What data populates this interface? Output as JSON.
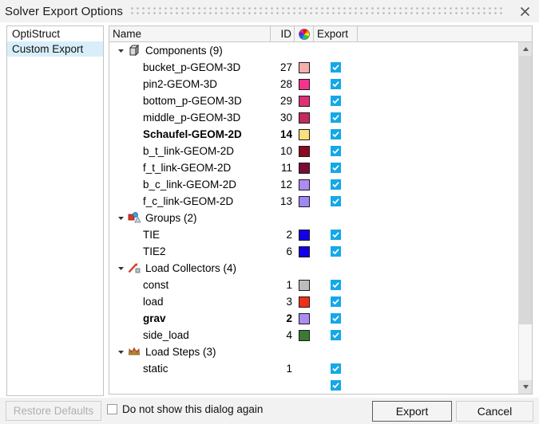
{
  "window": {
    "title": "Solver Export Options",
    "close_icon": "close-icon"
  },
  "left_list": {
    "items": [
      {
        "label": "OptiStruct",
        "selected": false
      },
      {
        "label": "Custom Export",
        "selected": true
      }
    ]
  },
  "tree": {
    "columns": {
      "name": "Name",
      "id": "ID",
      "color": "color-wheel-icon",
      "export": "Export"
    },
    "groups": [
      {
        "label": "Components (9)",
        "icon": "component-cube-icon",
        "expanded": true,
        "children": [
          {
            "name": "bucket_p-GEOM-3D",
            "id": "27",
            "color": "#f5b0ab",
            "export": true,
            "bold": false
          },
          {
            "name": "pin2-GEOM-3D",
            "id": "28",
            "color": "#f5338c",
            "export": true,
            "bold": false
          },
          {
            "name": "bottom_p-GEOM-3D",
            "id": "29",
            "color": "#e02e74",
            "export": true,
            "bold": false
          },
          {
            "name": "middle_p-GEOM-3D",
            "id": "30",
            "color": "#c42a5e",
            "export": true,
            "bold": false
          },
          {
            "name": "Schaufel-GEOM-2D",
            "id": "14",
            "color": "#f9e07c",
            "export": true,
            "bold": true
          },
          {
            "name": "b_t_link-GEOM-2D",
            "id": "10",
            "color": "#8c0a1e",
            "export": true,
            "bold": false
          },
          {
            "name": "f_t_link-GEOM-2D",
            "id": "11",
            "color": "#7d0a36",
            "export": true,
            "bold": false
          },
          {
            "name": "b_c_link-GEOM-2D",
            "id": "12",
            "color": "#ac8bf2",
            "export": true,
            "bold": false
          },
          {
            "name": "f_c_link-GEOM-2D",
            "id": "13",
            "color": "#a087f5",
            "export": true,
            "bold": false
          }
        ]
      },
      {
        "label": "Groups (2)",
        "icon": "groups-icon",
        "expanded": true,
        "children": [
          {
            "name": "TIE",
            "id": "2",
            "color": "#1200e8",
            "export": true,
            "bold": false
          },
          {
            "name": "TIE2",
            "id": "6",
            "color": "#1200e8",
            "export": true,
            "bold": false
          }
        ]
      },
      {
        "label": "Load Collectors (4)",
        "icon": "load-collector-icon",
        "expanded": true,
        "children": [
          {
            "name": "const",
            "id": "1",
            "color": "#bcbcbc",
            "export": true,
            "bold": false
          },
          {
            "name": "load",
            "id": "3",
            "color": "#ef3017",
            "export": true,
            "bold": false
          },
          {
            "name": "grav",
            "id": "2",
            "color": "#ac8bf2",
            "export": true,
            "bold": true
          },
          {
            "name": "side_load",
            "id": "4",
            "color": "#3a7a32",
            "export": true,
            "bold": false
          }
        ]
      },
      {
        "label": "Load Steps (3)",
        "icon": "load-steps-icon",
        "expanded": true,
        "children": [
          {
            "name": "static",
            "id": "1",
            "color": null,
            "export": true,
            "bold": false
          }
        ]
      }
    ],
    "scrollbar": {
      "up_icon": "scroll-up-arrow-icon",
      "down_icon": "scroll-down-arrow-icon"
    }
  },
  "footer": {
    "restore_defaults": "Restore Defaults",
    "do_not_show": "Do not show this dialog again",
    "do_not_show_checked": false,
    "export": "Export",
    "cancel": "Cancel"
  }
}
